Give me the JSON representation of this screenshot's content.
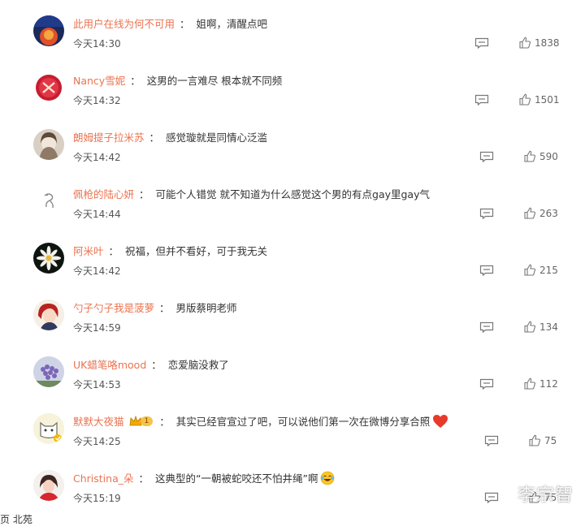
{
  "comments": [
    {
      "user": "此用户在线为何不可用",
      "text": "姐啊，清醒点吧",
      "time": "今天14:30",
      "likes": "1838"
    },
    {
      "user": "Nancy雪妮",
      "text": "这男的一言难尽 根本就不同频",
      "time": "今天14:32",
      "likes": "1501"
    },
    {
      "user": "朗姆提子拉米苏",
      "text": "感觉璇就是同情心泛滥",
      "time": "今天14:42",
      "likes": "590"
    },
    {
      "user": "佩枪的陆心妍",
      "text": "可能个人错觉 就不知道为什么感觉这个男的有点gay里gay气",
      "time": "今天14:44",
      "likes": "263"
    },
    {
      "user": "阿米叶",
      "text": "祝福，但并不看好，可于我无关",
      "time": "今天14:42",
      "likes": "215"
    },
    {
      "user": "勺子勺子我是菠萝",
      "text": "男版蔡明老师",
      "time": "今天14:59",
      "likes": "134"
    },
    {
      "user": "UK蜡笔咯mood",
      "text": "恋爱脑没救了",
      "time": "今天14:53",
      "likes": "112"
    },
    {
      "user": "默默大夜猫",
      "badge": "1",
      "text": "其实已经官宣过了吧，可以说他们第一次在微博分享合照",
      "time": "今天14:25",
      "likes": "75"
    },
    {
      "user": "Christina_朵",
      "text": "这典型的“一朝被蛇咬还不怕井绳”啊",
      "time": "今天15:19",
      "likes": "75"
    }
  ],
  "separator": "：",
  "watermark": "李宗智",
  "bottom_fragment": "页 北苑"
}
